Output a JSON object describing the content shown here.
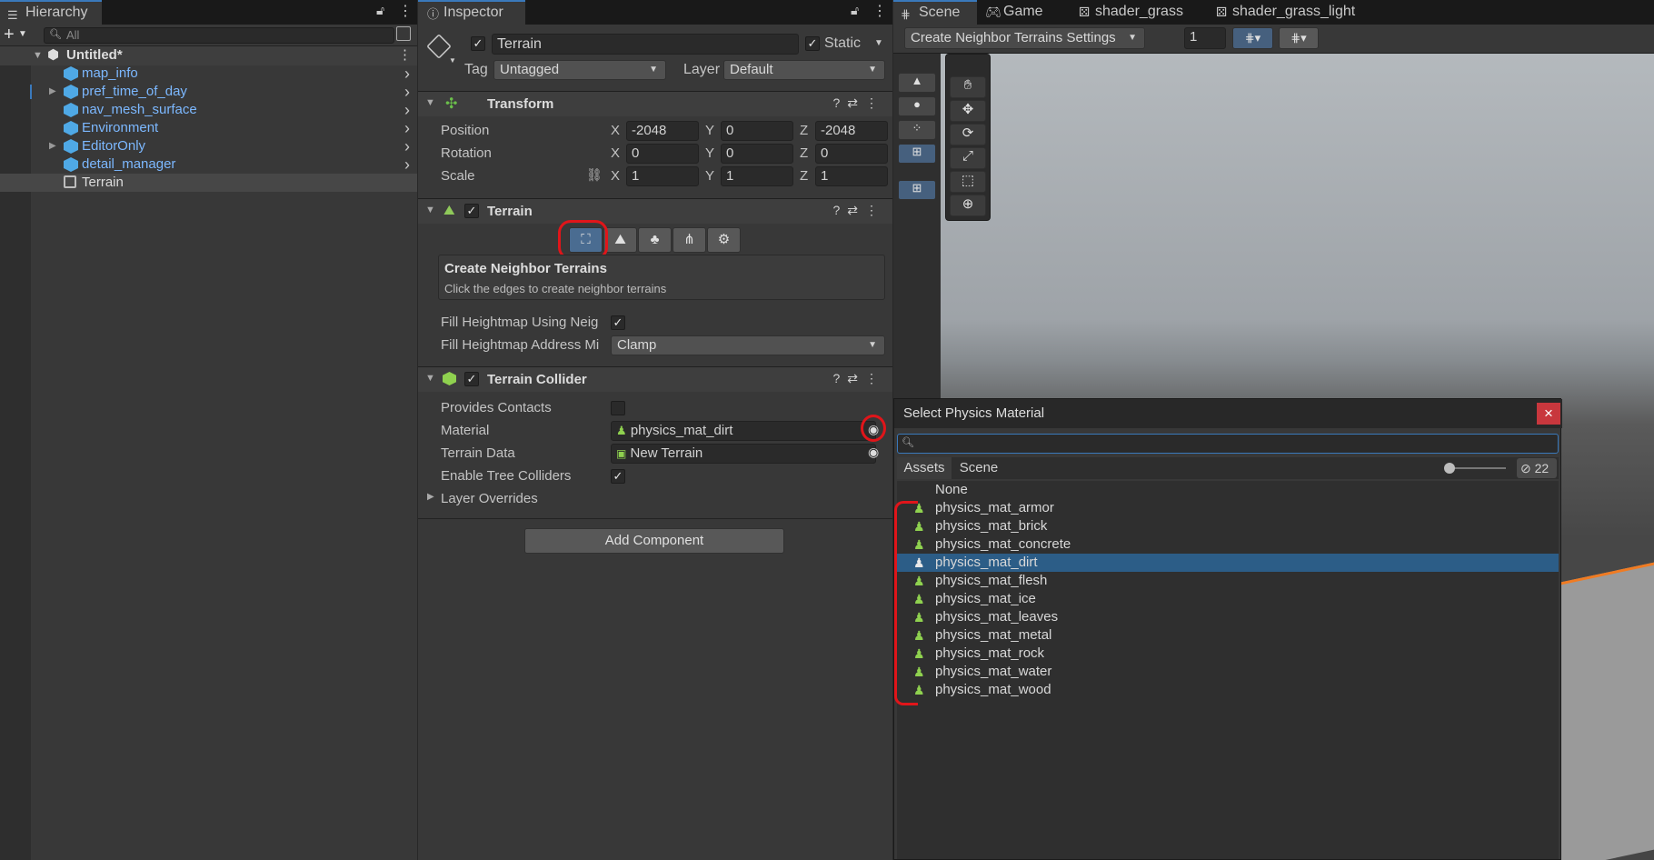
{
  "hierarchy": {
    "tab_label": "Hierarchy",
    "search_placeholder": "All",
    "scene_name": "Untitled*",
    "items": [
      {
        "label": "map_info"
      },
      {
        "label": "pref_time_of_day"
      },
      {
        "label": "nav_mesh_surface"
      },
      {
        "label": "Environment"
      },
      {
        "label": "EditorOnly"
      },
      {
        "label": "detail_manager"
      },
      {
        "label": "Terrain"
      }
    ]
  },
  "inspector": {
    "tab_label": "Inspector",
    "object_name": "Terrain",
    "static_label": "Static",
    "tag_label": "Tag",
    "tag_value": "Untagged",
    "layer_label": "Layer",
    "layer_value": "Default",
    "transform": {
      "title": "Transform",
      "position_label": "Position",
      "rotation_label": "Rotation",
      "scale_label": "Scale",
      "axis_x": "X",
      "axis_y": "Y",
      "axis_z": "Z",
      "position": [
        "-2048",
        "0",
        "-2048"
      ],
      "rotation": [
        "0",
        "0",
        "0"
      ],
      "scale": [
        "1",
        "1",
        "1"
      ]
    },
    "terrain": {
      "title": "Terrain",
      "box_title": "Create Neighbor Terrains",
      "box_desc": "Click the edges to create neighbor terrains",
      "fill_heightmap_label": "Fill Heightmap Using Neig",
      "fill_address_label": "Fill Heightmap Address Mi",
      "fill_address_value": "Clamp"
    },
    "collider": {
      "title": "Terrain Collider",
      "provides_contacts_label": "Provides Contacts",
      "material_label": "Material",
      "material_value": "physics_mat_dirt",
      "terrain_data_label": "Terrain Data",
      "terrain_data_value": "New Terrain",
      "tree_colliders_label": "Enable Tree Colliders",
      "layer_overrides_label": "Layer Overrides"
    },
    "add_component_label": "Add Component"
  },
  "scene": {
    "tabs": [
      "Scene",
      "Game",
      "shader_grass",
      "shader_grass_light"
    ],
    "tool_dropdown": "Create Neighbor Terrains Settings",
    "zoom_value": "1"
  },
  "picker": {
    "title": "Select Physics Material",
    "close_label": "×",
    "tab_assets": "Assets",
    "tab_scene": "Scene",
    "hidden_count": "22",
    "none_label": "None",
    "items": [
      {
        "label": "physics_mat_armor"
      },
      {
        "label": "physics_mat_brick"
      },
      {
        "label": "physics_mat_concrete"
      },
      {
        "label": "physics_mat_dirt",
        "selected": true
      },
      {
        "label": "physics_mat_flesh"
      },
      {
        "label": "physics_mat_ice"
      },
      {
        "label": "physics_mat_leaves"
      },
      {
        "label": "physics_mat_metal"
      },
      {
        "label": "physics_mat_rock"
      },
      {
        "label": "physics_mat_water"
      },
      {
        "label": "physics_mat_wood"
      }
    ]
  },
  "colors": {
    "accent_blue": "#3a79bb",
    "annotation_red": "#e0151a",
    "selection": "#2c5d87"
  }
}
